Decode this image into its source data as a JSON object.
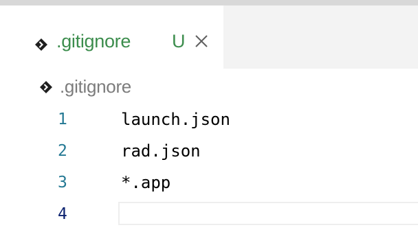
{
  "tab": {
    "icon": "gitignore-file-icon",
    "title": ".gitignore",
    "status": "U",
    "close_icon": "close-icon"
  },
  "breadcrumb": {
    "icon": "gitignore-file-icon",
    "label": ".gitignore"
  },
  "editor": {
    "lines": [
      {
        "number": "1",
        "text": "launch.json"
      },
      {
        "number": "2",
        "text": "rad.json"
      },
      {
        "number": "3",
        "text": "*.app"
      },
      {
        "number": "4",
        "text": ""
      }
    ],
    "current_line": "4"
  },
  "colors": {
    "untracked": "#3c8d4d",
    "line_number": "#237893",
    "current_line_number": "#0b216f",
    "icon": "#1f1f1f"
  }
}
